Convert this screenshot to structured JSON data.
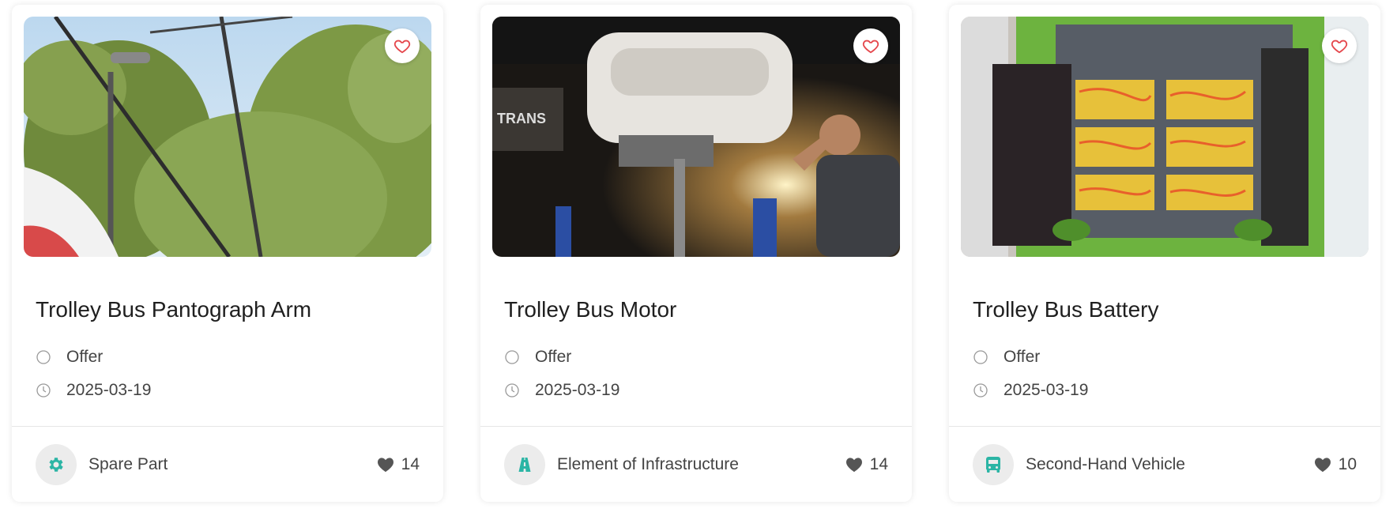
{
  "colors": {
    "accent_teal": "#2bb5a5",
    "favorite_red": "#e5484d",
    "text_dark": "#1f1f1f",
    "text_muted": "#444444"
  },
  "cards": [
    {
      "title": "Trolley Bus Pantograph Arm",
      "type": "Offer",
      "date": "2025-03-19",
      "category": "Spare Part",
      "category_icon": "gear-icon",
      "likes": "14",
      "image_subject": "pantograph-photo"
    },
    {
      "title": "Trolley Bus Motor",
      "type": "Offer",
      "date": "2025-03-19",
      "category": "Element of Infrastructure",
      "category_icon": "road-icon",
      "likes": "14",
      "image_subject": "motor-photo"
    },
    {
      "title": "Trolley Bus Battery",
      "type": "Offer",
      "date": "2025-03-19",
      "category": "Second-Hand Vehicle",
      "category_icon": "bus-icon",
      "likes": "10",
      "image_subject": "battery-photo"
    }
  ]
}
